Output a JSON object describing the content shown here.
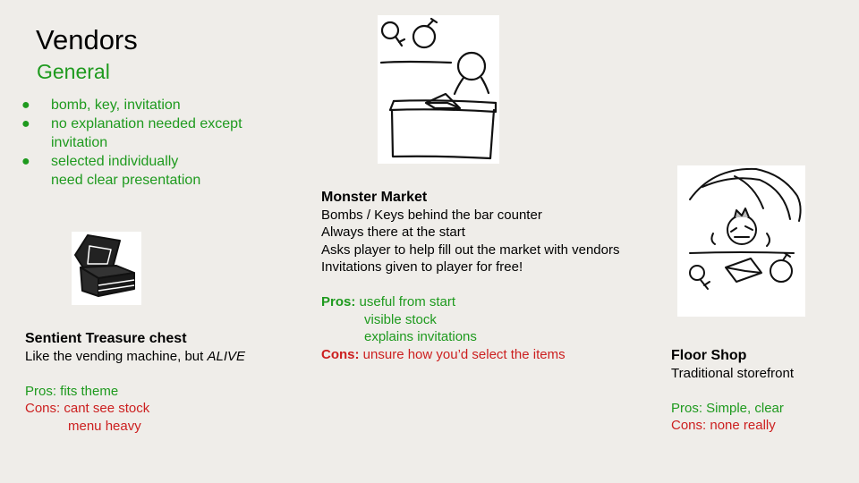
{
  "slide": {
    "title": "Vendors",
    "subtitle": "General",
    "bullets": [
      {
        "marker": "●",
        "lines": [
          "bomb, key, invitation"
        ]
      },
      {
        "marker": "●",
        "lines": [
          "no explanation needed except",
          "invitation"
        ]
      },
      {
        "marker": "●",
        "lines": [
          "selected individually",
          "need clear presentation"
        ]
      }
    ]
  },
  "chest": {
    "name": "Sentient Treasure chest",
    "desc_prefix": "Like the vending machine, but ",
    "desc_emph": "ALIVE",
    "pros_line": "Pros: fits theme",
    "cons_line": "Cons: cant see stock",
    "cons_cont": "menu heavy"
  },
  "market": {
    "name": "Monster Market",
    "lines": [
      "Bombs / Keys behind the bar counter",
      "Always there at the start",
      "Asks player to help fill out the market with vendors",
      "Invitations given to player for free!"
    ],
    "pros_label": "Pros:",
    "pros_first": " useful from start",
    "pros_more": [
      "visible stock",
      "explains invitations"
    ],
    "cons_label": "Cons:",
    "cons_text": " unsure how you’d select the items"
  },
  "floor": {
    "name": "Floor Shop",
    "desc": "Traditional storefront",
    "pros_line": "Pros: Simple, clear",
    "cons_line": "Cons: none really"
  },
  "colors": {
    "background": "#efede9",
    "green": "#1e9a1e",
    "red": "#cc1f1f"
  }
}
